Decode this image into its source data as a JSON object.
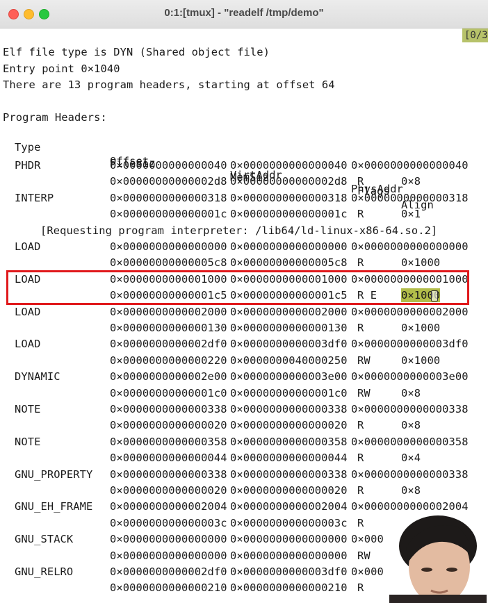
{
  "window": {
    "title": "0:1:[tmux] - \"readelf /tmp/demo\"",
    "tmux_status": "[0/3"
  },
  "terminal": {
    "intro": [
      "Elf file type is DYN (Shared object file)",
      "Entry point 0×1040",
      "There are 13 program headers, starting at offset 64"
    ],
    "section_title": "Program Headers:",
    "headers_row1": {
      "type": "Type",
      "offset": "Offset",
      "virt": "VirtAddr",
      "phys": "PhysAddr"
    },
    "headers_row2": {
      "filesiz": "FileSiz",
      "memsiz": "MemSiz",
      "flags": "Flags",
      "align": "Align"
    },
    "interp_note": "[Requesting program interpreter: /lib64/ld-linux-x86-64.so.2]",
    "rows": [
      {
        "type": "PHDR",
        "offset": "0×0000000000000040",
        "virt": "0×0000000000000040",
        "phys": "0×0000000000000040",
        "filesiz": "0×00000000000002d8",
        "memsiz": "0×00000000000002d8",
        "flags": "R",
        "align": "0×8"
      },
      {
        "type": "INTERP",
        "offset": "0×0000000000000318",
        "virt": "0×0000000000000318",
        "phys": "0×0000000000000318",
        "filesiz": "0×000000000000001c",
        "memsiz": "0×000000000000001c",
        "flags": "R",
        "align": "0×1"
      },
      {
        "type": "LOAD",
        "offset": "0×0000000000000000",
        "virt": "0×0000000000000000",
        "phys": "0×0000000000000000",
        "filesiz": "0×00000000000005c8",
        "memsiz": "0×00000000000005c8",
        "flags": "R",
        "align": "0×1000"
      },
      {
        "type": "LOAD",
        "offset": "0×0000000000001000",
        "virt": "0×0000000000001000",
        "phys": "0×0000000000001000",
        "filesiz": "0×00000000000001c5",
        "memsiz": "0×00000000000001c5",
        "flags": "R E",
        "align": "0×1000"
      },
      {
        "type": "LOAD",
        "offset": "0×0000000000002000",
        "virt": "0×0000000000002000",
        "phys": "0×0000000000002000",
        "filesiz": "0×0000000000000130",
        "memsiz": "0×0000000000000130",
        "flags": "R",
        "align": "0×1000"
      },
      {
        "type": "LOAD",
        "offset": "0×0000000000002df0",
        "virt": "0×0000000000003df0",
        "phys": "0×0000000000003df0",
        "filesiz": "0×0000000000000220",
        "memsiz": "0×0000000040000250",
        "flags": "RW",
        "align": "0×1000"
      },
      {
        "type": "DYNAMIC",
        "offset": "0×0000000000002e00",
        "virt": "0×0000000000003e00",
        "phys": "0×0000000000003e00",
        "filesiz": "0×00000000000001c0",
        "memsiz": "0×00000000000001c0",
        "flags": "RW",
        "align": "0×8"
      },
      {
        "type": "NOTE",
        "offset": "0×0000000000000338",
        "virt": "0×0000000000000338",
        "phys": "0×0000000000000338",
        "filesiz": "0×0000000000000020",
        "memsiz": "0×0000000000000020",
        "flags": "R",
        "align": "0×8"
      },
      {
        "type": "NOTE",
        "offset": "0×0000000000000358",
        "virt": "0×0000000000000358",
        "phys": "0×0000000000000358",
        "filesiz": "0×0000000000000044",
        "memsiz": "0×0000000000000044",
        "flags": "R",
        "align": "0×4"
      },
      {
        "type": "GNU_PROPERTY",
        "offset": "0×0000000000000338",
        "virt": "0×0000000000000338",
        "phys": "0×0000000000000338",
        "filesiz": "0×0000000000000020",
        "memsiz": "0×0000000000000020",
        "flags": "R",
        "align": "0×8"
      },
      {
        "type": "GNU_EH_FRAME",
        "offset": "0×0000000000002004",
        "virt": "0×0000000000002004",
        "phys": "0×0000000000002004",
        "filesiz": "0×000000000000003c",
        "memsiz": "0×000000000000003c",
        "flags": "R",
        "align": ""
      },
      {
        "type": "GNU_STACK",
        "offset": "0×0000000000000000",
        "virt": "0×0000000000000000",
        "phys": "0×000",
        "filesiz": "0×0000000000000000",
        "memsiz": "0×0000000000000000",
        "flags": "RW",
        "align": ""
      },
      {
        "type": "GNU_RELRO",
        "offset": "0×0000000000002df0",
        "virt": "0×0000000000003df0",
        "phys": "0×000",
        "filesiz": "0×0000000000000210",
        "memsiz": "0×0000000000000210",
        "flags": "R",
        "align": ""
      }
    ]
  },
  "annotations": {
    "highlight_row_index": 3,
    "highlight_color": "#e0191c",
    "selection_color": "#b2bd4a"
  }
}
